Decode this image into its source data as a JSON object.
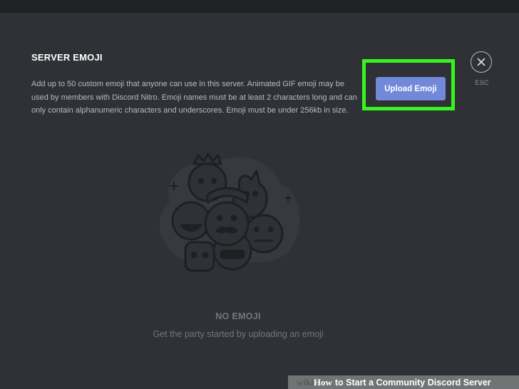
{
  "modal": {
    "title": "SERVER EMOJI",
    "description": "Add up to 50 custom emoji that anyone can use in this server. Animated GIF emoji may be used by members with Discord Nitro. Emoji names must be at least 2 characters long and can only contain alphanumeric characters and underscores. Emoji must be under 256kb in size.",
    "upload_button_label": "Upload Emoji",
    "close_icon": "close-icon",
    "esc_label": "ESC"
  },
  "empty_state": {
    "title": "NO EMOJI",
    "subtitle": "Get the party started by uploading an emoji"
  },
  "watermark": {
    "brand": "wiki",
    "how": "How",
    "rest": "to Start a Community Discord Server"
  },
  "colors": {
    "background": "#2f3136",
    "top_bar": "#202225",
    "accent_button": "#7289da",
    "highlight": "#35f51c",
    "text_primary": "#ffffff",
    "text_secondary": "#b9bbbe",
    "text_muted": "#72767d"
  }
}
